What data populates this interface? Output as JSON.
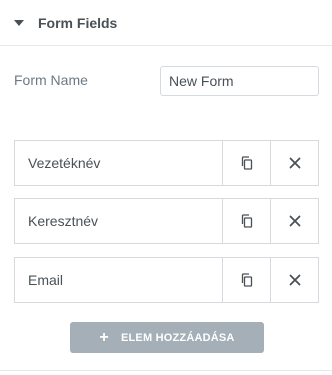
{
  "section": {
    "title": "Form Fields",
    "icon": "caret-down-icon"
  },
  "form_name": {
    "label": "Form Name",
    "value": "New Form"
  },
  "fields": [
    {
      "label": "Vezetéknév"
    },
    {
      "label": "Keresztnév"
    },
    {
      "label": "Email"
    }
  ],
  "tools": {
    "duplicate_icon": "copy-icon",
    "remove_icon": "close-icon"
  },
  "add_button": {
    "icon": "+",
    "label": "ELEM HOZZÁADÁSA",
    "color": "#a4afb7"
  }
}
